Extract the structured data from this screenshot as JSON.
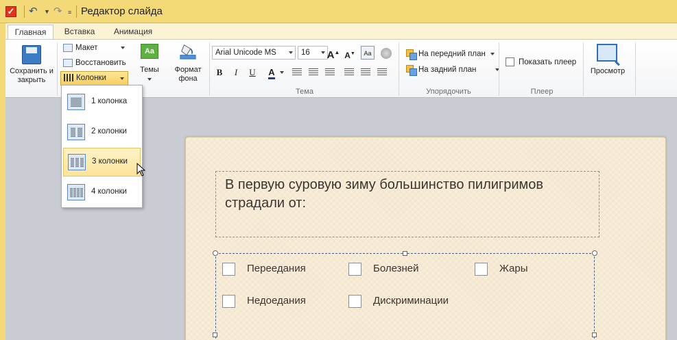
{
  "window": {
    "title": "Редактор слайда"
  },
  "tabs": [
    {
      "label": "Главная",
      "active": true
    },
    {
      "label": "Вставка",
      "active": false
    },
    {
      "label": "Анимация",
      "active": false
    }
  ],
  "ribbon": {
    "save_close": "Сохранить и закрыть",
    "layout": "Макет",
    "restore": "Восстановить",
    "columns": "Колонки",
    "themes": "Темы",
    "themes_icon_text": "Aa",
    "bg_format": "Формат фона",
    "font_name": "Arial Unicode MS",
    "font_size": "16",
    "group_theme": "Тема",
    "bring_front": "На передний план",
    "send_back": "На задний план",
    "group_arrange": "Упорядочить",
    "show_player": "Показать плеер",
    "group_player": "Плеер",
    "preview": "Просмотр"
  },
  "columns_menu": [
    {
      "label": "1 колонка",
      "cols": 1,
      "hover": false
    },
    {
      "label": "2 колонки",
      "cols": 2,
      "hover": false
    },
    {
      "label": "3 колонки",
      "cols": 3,
      "hover": true
    },
    {
      "label": "4 колонки",
      "cols": 4,
      "hover": false
    }
  ],
  "slide": {
    "question": "В первую суровую зиму большинство пилигримов страдали от:",
    "answers": [
      "Переедания",
      "Болезней",
      "Жары",
      "Недоедания",
      "Дискриминации"
    ]
  },
  "colors": {
    "title_bar": "#f4d978",
    "hover": "#fde39a",
    "slide_bg": "#f7ead4",
    "accent": "#2f6fb8"
  }
}
